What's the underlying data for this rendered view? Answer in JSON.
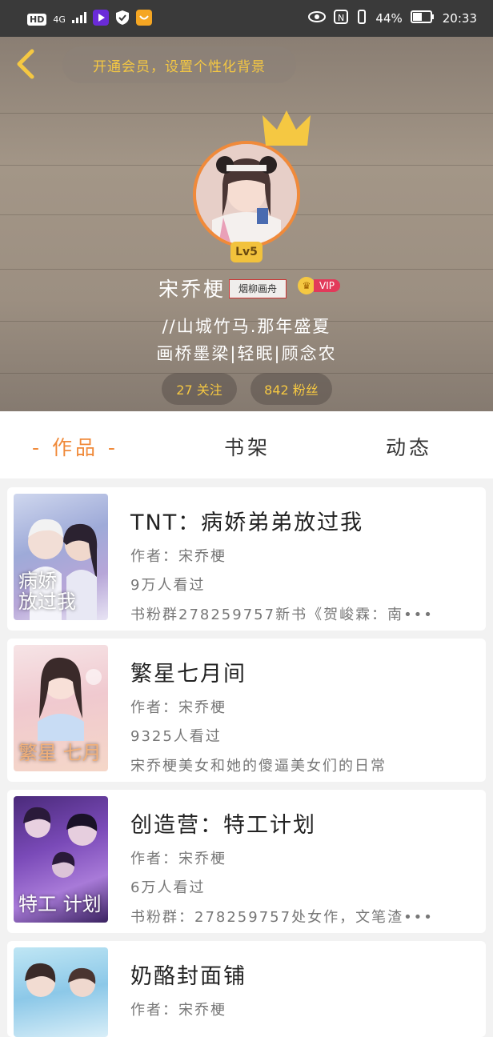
{
  "status_bar": {
    "left_items": [
      "HD",
      "4G"
    ],
    "battery": "44%",
    "time": "20:33"
  },
  "header": {
    "vip_banner": "开通会员，设置个性化背景"
  },
  "profile": {
    "level": "Lv5",
    "username": "宋乔梗",
    "tag": "烟柳画舟",
    "vip_label": "VIP",
    "bio_line1": "//山城竹马.那年盛夏",
    "bio_line2": "画桥墨梁|轻眠|顾念农",
    "following": "27 关注",
    "followers": "842 粉丝"
  },
  "tabs": [
    {
      "label": "- 作品 -",
      "active": true
    },
    {
      "label": "书架",
      "active": false
    },
    {
      "label": "动态",
      "active": false
    }
  ],
  "books": [
    {
      "title": "TNT：病娇弟弟放过我",
      "author": "作者：宋乔梗",
      "views": "9万人看过",
      "desc": "书粉群278259757新书《贺峻霖：南•••",
      "cover_text": "病娇\n放过我"
    },
    {
      "title": "繁星七月间",
      "author": "作者：宋乔梗",
      "views": "9325人看过",
      "desc": "宋乔梗美女和她的傻逼美女们的日常",
      "cover_text": "繁星\n七月"
    },
    {
      "title": "创造营：特工计划",
      "author": "作者：宋乔梗",
      "views": "6万人看过",
      "desc": "书粉群：278259757处女作，文笔渣•••",
      "cover_text": "特工\n计划"
    },
    {
      "title": "奶酪封面铺",
      "author": "作者：宋乔梗",
      "views": "",
      "desc": "",
      "cover_text": ""
    }
  ],
  "colors": {
    "accent": "#f08a3a",
    "gold": "#f5c842",
    "status_bar": "#3a3a3a"
  }
}
